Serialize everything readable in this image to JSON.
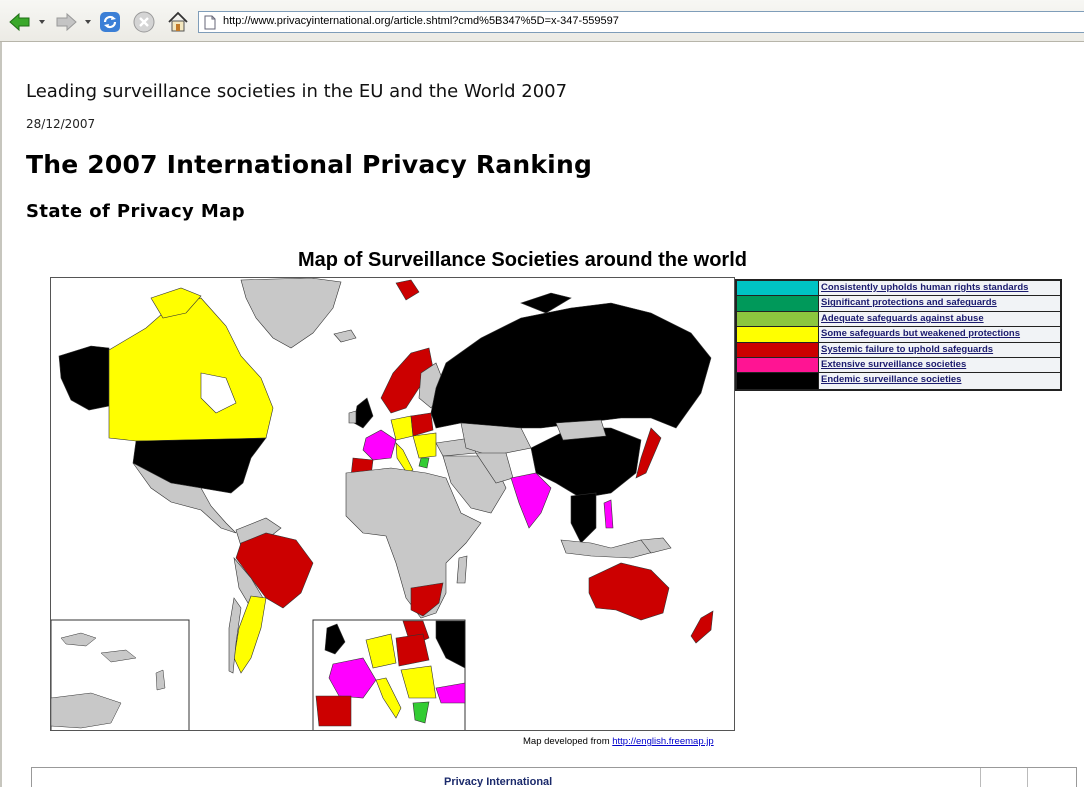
{
  "browser": {
    "url": "http://www.privacyinternational.org/article.shtml?cmd%5B347%5D=x-347-559597",
    "icons": [
      "back-arrow-icon",
      "forward-arrow-icon",
      "refresh-icon",
      "stop-icon",
      "home-icon",
      "page-icon"
    ]
  },
  "article": {
    "kicker": "Leading surveillance societies in the EU and the World 2007",
    "date": "28/12/2007",
    "title": "The 2007 International Privacy Ranking",
    "subtitle": "State of Privacy Map"
  },
  "map": {
    "title": "Map of Surveillance Societies around the world",
    "legend": [
      {
        "label": "Consistently upholds human rights standards",
        "color": "#00c4c4"
      },
      {
        "label": "Significant protections and safeguards",
        "color": "#00995a"
      },
      {
        "label": "Adequate safeguards against abuse",
        "color": "#8cc63f"
      },
      {
        "label": "Some safeguards but weakened protections",
        "color": "#ffff00"
      },
      {
        "label": "Systemic failure to uphold safeguards",
        "color": "#cc0000"
      },
      {
        "label": "Extensive surveillance societies",
        "color": "#ff1493"
      },
      {
        "label": "Endemic surveillance societies",
        "color": "#000000"
      }
    ],
    "credit_text": "Map developed from ",
    "credit_link": "http://english.freemap.jp"
  },
  "colors": {
    "land_neutral": "#c8c8c8",
    "magenta": "#ff00ff",
    "green": "#33cc33"
  },
  "footer": {
    "org": "Privacy International"
  }
}
